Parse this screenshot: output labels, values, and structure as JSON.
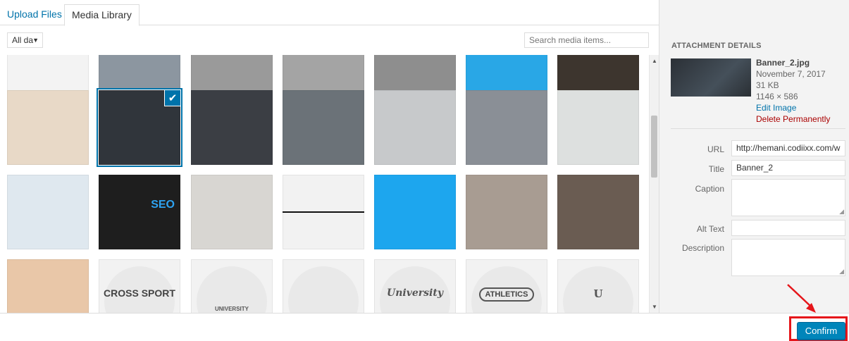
{
  "tabs": [
    {
      "label": "Upload Files",
      "active": false
    },
    {
      "label": "Media Library",
      "active": true
    }
  ],
  "toolbar": {
    "filter_value": "All da",
    "search_placeholder": "Search media items..."
  },
  "grid": {
    "rows": [
      [
        {
          "kind": "cropped-tile",
          "bg": "#f3f3f3"
        },
        {
          "kind": "photo-woman",
          "bg": "#8c96a0"
        },
        {
          "kind": "photo-man-bw",
          "bg": "#9a9a9a"
        },
        {
          "kind": "photo-man-bw",
          "bg": "#a4a4a4"
        },
        {
          "kind": "photo-man-bw",
          "bg": "#8e8e8e"
        },
        {
          "kind": "blue-banner",
          "bg": "#29a7e6"
        },
        {
          "kind": "photo-man-dark",
          "bg": "#3d352e"
        }
      ],
      [
        {
          "kind": "photo-bearded-man",
          "bg": "#e8d9c7"
        },
        {
          "kind": "banner-dark",
          "bg": "#30353b",
          "selected": true
        },
        {
          "kind": "banner-graph",
          "bg": "#3b3e44"
        },
        {
          "kind": "photo-old-man",
          "bg": "#6b7278"
        },
        {
          "kind": "photo-glasses-desk",
          "bg": "#c7c9cb"
        },
        {
          "kind": "photo-tablet",
          "bg": "#8a8f96"
        },
        {
          "kind": "photo-plant",
          "bg": "#dde0df"
        }
      ],
      [
        {
          "kind": "website-mockup",
          "bg": "#dfe8ef"
        },
        {
          "kind": "seo-banner",
          "bg": "#1e1e1e"
        },
        {
          "kind": "photo-laptop-woman",
          "bg": "#d8d6d2"
        },
        {
          "kind": "plain-line",
          "bg": "#f2f2f2"
        },
        {
          "kind": "blue-panel",
          "bg": "#1da6ee"
        },
        {
          "kind": "photo-woman-glasses",
          "bg": "#a89c92"
        },
        {
          "kind": "photo-businessman",
          "bg": "#6a5c52"
        }
      ],
      [
        {
          "kind": "photo-blonde",
          "bg": "#e9c7a8"
        },
        {
          "kind": "logo-cross-sport",
          "bg": "#f2f2f2",
          "logo": "CROSS SPORT"
        },
        {
          "kind": "logo-university",
          "bg": "#f2f2f2",
          "logo": "UNIVERSITY"
        },
        {
          "kind": "logo-wreath",
          "bg": "#f2f2f2",
          "logo": ""
        },
        {
          "kind": "logo-university-script",
          "bg": "#f2f2f2",
          "logo": "University"
        },
        {
          "kind": "logo-athletics",
          "bg": "#f2f2f2",
          "logo": "ATHLETICS"
        },
        {
          "kind": "logo-shield",
          "bg": "#f2f2f2",
          "logo": "U"
        }
      ]
    ]
  },
  "sidebar": {
    "title": "ATTACHMENT DETAILS",
    "file": {
      "name": "Banner_2.jpg",
      "date": "November 7, 2017",
      "size": "31 KB",
      "dimensions": "1146 × 586",
      "edit_label": "Edit Image",
      "delete_label": "Delete Permanently"
    },
    "fields": {
      "url_label": "URL",
      "url_value": "http://hemani.codiixx.com/w",
      "title_label": "Title",
      "title_value": "Banner_2",
      "caption_label": "Caption",
      "caption_value": "",
      "alt_label": "Alt Text",
      "alt_value": "",
      "description_label": "Description",
      "description_value": ""
    }
  },
  "footer": {
    "confirm_label": "Confirm"
  },
  "colors": {
    "accent": "#0073aa",
    "button": "#0085ba",
    "danger": "#a00",
    "highlight": "#e5151a"
  }
}
